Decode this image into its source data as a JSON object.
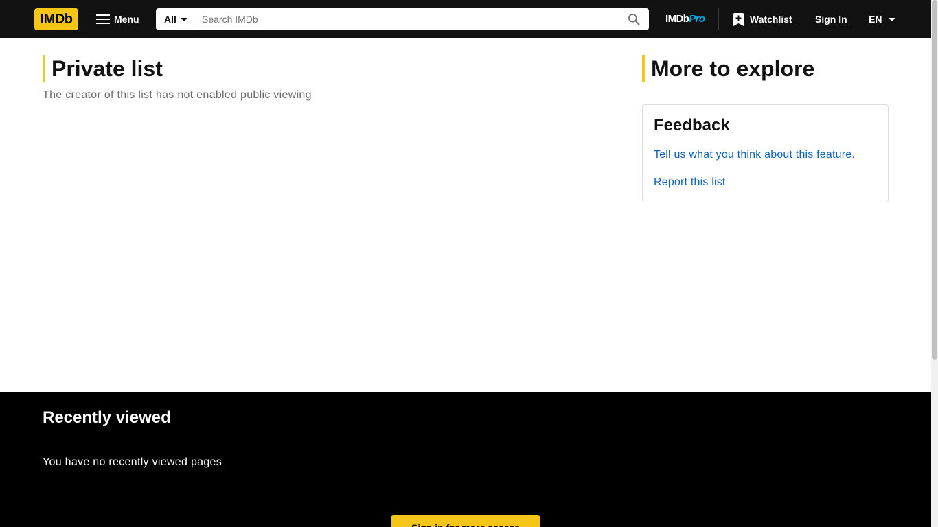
{
  "nav": {
    "logo": "IMDb",
    "menu_label": "Menu",
    "search_category": "All",
    "search_placeholder": "Search IMDb",
    "search_value": "",
    "pro_part1": "IMDb",
    "pro_part2": "Pro",
    "watchlist_label": "Watchlist",
    "signin_label": "Sign In",
    "language": "EN"
  },
  "main": {
    "title": "Private list",
    "subtitle": "The creator of this list has not enabled public viewing"
  },
  "sidebar": {
    "title": "More to explore",
    "feedback": {
      "title": "Feedback",
      "link_feedback": "Tell us what you think about this feature.",
      "link_report": "Report this list"
    }
  },
  "recently_viewed": {
    "title": "Recently viewed",
    "empty_message": "You have no recently viewed pages",
    "signin_button": "Sign in for more access"
  },
  "colors": {
    "brand_yellow": "#f5c518",
    "nav_bg": "#121212",
    "link_blue": "#0e63be",
    "pro_blue": "#00a8e1"
  },
  "icons": {
    "menu": "hamburger-menu-icon",
    "search": "magnifier-icon",
    "watchlist": "bookmark-plus-icon",
    "caret": "caret-down-icon"
  }
}
